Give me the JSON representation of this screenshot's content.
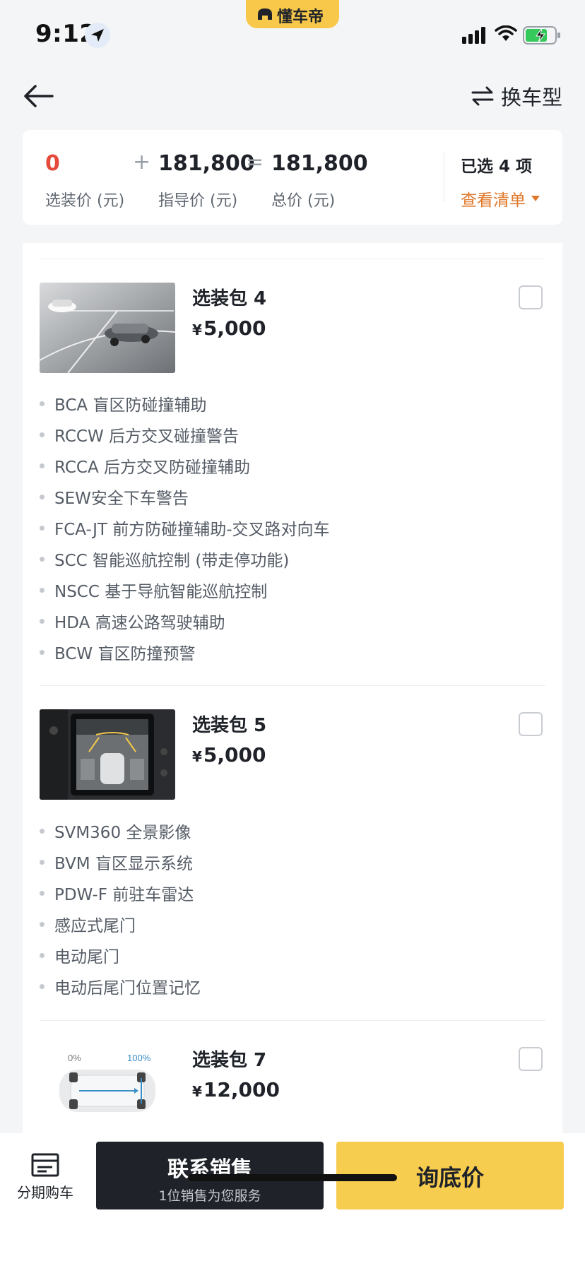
{
  "status_bar": {
    "time": "9:12"
  },
  "app_badge": {
    "label": "懂车帝"
  },
  "nav": {
    "change_label": "换车型"
  },
  "price_summary": {
    "option_price": "0",
    "option_label": "选装价 (元)",
    "plus": "+",
    "guide_price": "181,800",
    "guide_label": "指导价 (元)",
    "equals": "=",
    "total_price": "181,800",
    "total_label": "总价 (元)",
    "selected_text": "已选 4 项",
    "view_list": "查看清单"
  },
  "packages": [
    {
      "title": "选装包 4",
      "currency": "¥",
      "price": "5,000",
      "features": [
        "BCA 盲区防碰撞辅助",
        "RCCW 后方交叉碰撞警告",
        "RCCA 后方交叉防碰撞辅助",
        "SEW安全下车警告",
        "FCA-JT 前方防碰撞辅助-交叉路对向车",
        "SCC 智能巡航控制 (带走停功能)",
        "NSCC 基于导航智能巡航控制",
        "HDA 高速公路驾驶辅助",
        "BCW 盲区防撞预警"
      ]
    },
    {
      "title": "选装包 5",
      "currency": "¥",
      "price": "5,000",
      "features": [
        "SVM360 全景影像",
        "BVM 盲区显示系统",
        "PDW-F 前驻车雷达",
        "感应式尾门",
        "电动尾门",
        "电动后尾门位置记忆"
      ]
    },
    {
      "title": "选装包 7",
      "currency": "¥",
      "price": "12,000",
      "img_label_left": "0%",
      "img_label_right": "100%",
      "features": []
    }
  ],
  "bottom_bar": {
    "installment_label": "分期购车",
    "contact_main": "联系销售",
    "contact_sub": "1位销售为您服务",
    "inquiry_label": "询底价"
  }
}
